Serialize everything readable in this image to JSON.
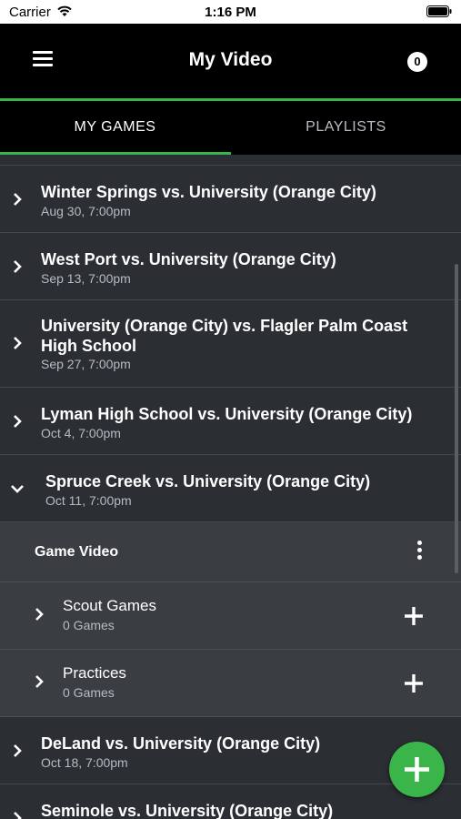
{
  "status_bar": {
    "carrier": "Carrier",
    "time": "1:16 PM"
  },
  "header": {
    "title": "My Video",
    "notification_count": "0"
  },
  "tabs": [
    {
      "label": "MY GAMES",
      "selected": true
    },
    {
      "label": "PLAYLISTS",
      "selected": false
    }
  ],
  "games": [
    {
      "name": "Winter Springs vs. University (Orange City)",
      "date": "Aug 30, 7:00pm"
    },
    {
      "name": "West Port vs. University (Orange City)",
      "date": "Sep 13, 7:00pm"
    },
    {
      "name": "University (Orange City) vs. Flagler Palm Coast High School",
      "date": "Sep 27, 7:00pm"
    },
    {
      "name": "Lyman High School vs. University (Orange City)",
      "date": "Oct 4, 7:00pm"
    },
    {
      "name": "Spruce Creek vs. University (Orange City)",
      "date": "Oct 11, 7:00pm",
      "expanded": true
    },
    {
      "name": "DeLand vs. University (Orange City)",
      "date": "Oct 18, 7:00pm"
    },
    {
      "name": "Seminole vs. University (Orange City)",
      "date": ""
    }
  ],
  "expanded_section": {
    "header": "Game Video",
    "items": [
      {
        "name": "Scout Games",
        "count": "0 Games"
      },
      {
        "name": "Practices",
        "count": "0 Games"
      }
    ]
  },
  "colors": {
    "accent": "#3ab54a",
    "background": "#2b2e33",
    "sub_background": "#3a3d42",
    "bar": "#000000"
  },
  "icons": [
    "wifi-icon",
    "battery-icon",
    "menu-icon",
    "chevron-right-icon",
    "chevron-down-icon",
    "more-vertical-icon",
    "plus-icon"
  ]
}
